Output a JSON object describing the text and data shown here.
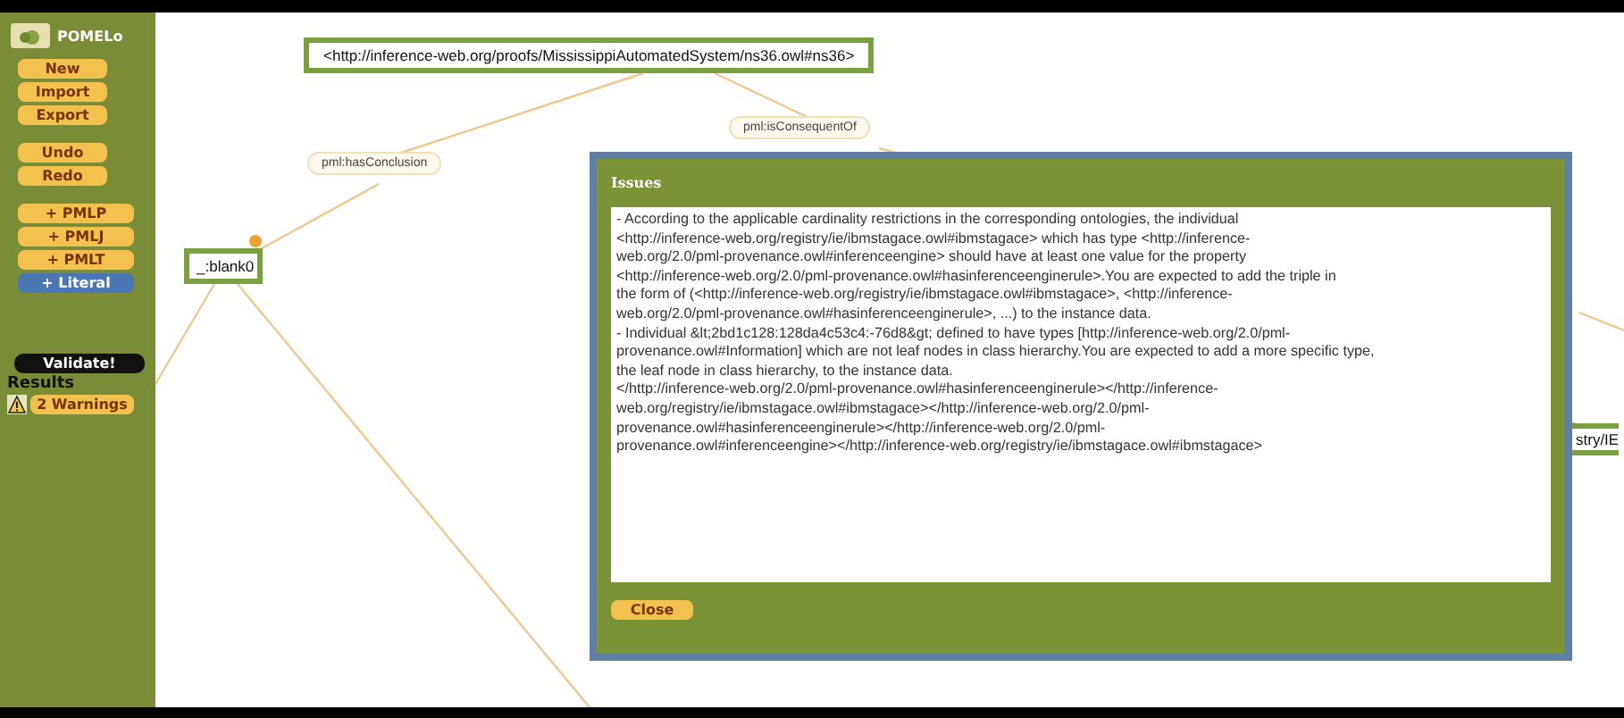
{
  "sidebar": {
    "app_name": "POMELo",
    "button_groups": [
      [
        {
          "label": "New",
          "kind": "plain"
        },
        {
          "label": "Import",
          "kind": "plain"
        },
        {
          "label": "Export",
          "kind": "plain"
        }
      ],
      [
        {
          "label": "Undo",
          "kind": "plain"
        },
        {
          "label": "Redo",
          "kind": "plain"
        }
      ],
      [
        {
          "label": "+ PMLP",
          "kind": "wide"
        },
        {
          "label": "+ PMLJ",
          "kind": "wide"
        },
        {
          "label": "+ PMLT",
          "kind": "wide"
        },
        {
          "label": "+ Literal",
          "kind": "literal"
        }
      ]
    ],
    "validate_button": "Validate!",
    "results_label": "Results",
    "warnings_button": "2 Warnings"
  },
  "graph": {
    "nodes": [
      {
        "label": "<http://inference-web.org/proofs/MississippiAutomatedSystem/ns36.owl#ns36>",
        "kind": "resource"
      },
      {
        "label": "_:blank0",
        "kind": "resource"
      },
      {
        "label": "stry/IE",
        "kind": "resource"
      },
      {
        "label": "pml:hasConclusion",
        "kind": "property"
      },
      {
        "label": "pml:isConsequentOf",
        "kind": "property"
      }
    ]
  },
  "dialog": {
    "title": "Issues",
    "lines": [
      "- According to the applicable cardinality restrictions in the corresponding ontologies, the individual",
      "<http://inference-web.org/registry/ie/ibmstagace.owl#ibmstagace> which has type <http://inference-",
      "web.org/2.0/pml-provenance.owl#inferenceengine> should have at least one value for the property",
      "<http://inference-web.org/2.0/pml-provenance.owl#hasinferenceenginerule>.You are expected to add the triple in",
      "the form of (<http://inference-web.org/registry/ie/ibmstagace.owl#ibmstagace>, <http://inference-",
      "web.org/2.0/pml-provenance.owl#hasinferenceenginerule>, ...) to the instance data.",
      "- Individual &lt;2bd1c128:128da4c53c4:-76d8&gt; defined to have types [http://inference-web.org/2.0/pml-",
      "provenance.owl#Information] which are not leaf nodes in class hierarchy.You are expected to add a more specific type,",
      "the leaf node in class hierarchy, to the instance data.",
      "</http://inference-web.org/2.0/pml-provenance.owl#hasinferenceenginerule></http://inference-",
      "web.org/registry/ie/ibmstagace.owl#ibmstagace></http://inference-web.org/2.0/pml-",
      "provenance.owl#hasinferenceenginerule></http://inference-web.org/2.0/pml-",
      "provenance.owl#inferenceengine></http://inference-web.org/registry/ie/ibmstagace.owl#ibmstagace>"
    ],
    "close_button": "Close"
  }
}
